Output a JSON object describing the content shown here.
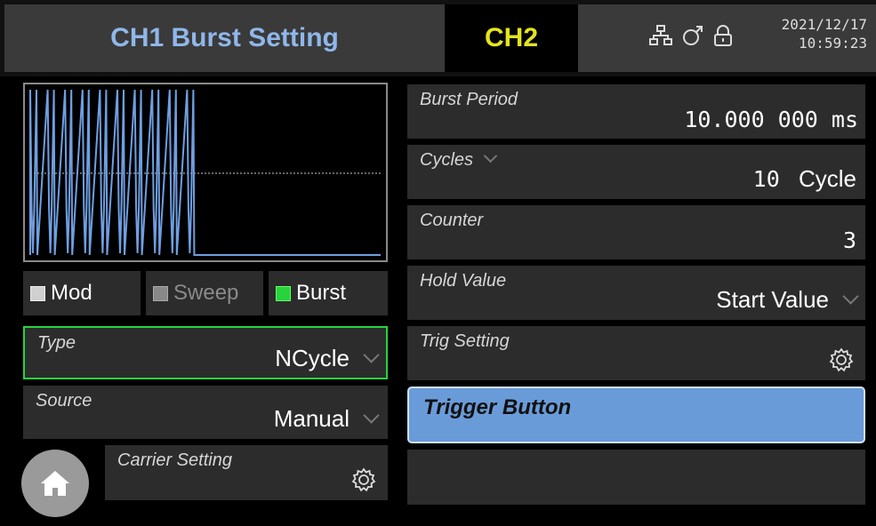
{
  "header": {
    "active_tab": "CH1 Burst Setting",
    "other_tab": "CH2",
    "date": "2021/12/17",
    "time": "10:59:23",
    "icons": [
      "network-icon",
      "link-icon",
      "lock-icon"
    ]
  },
  "waveform": {
    "pulse_count": 10,
    "trace_color": "#6f9fe0",
    "reference_line_color": "#cccccc"
  },
  "modes": {
    "mod": {
      "label": "Mod",
      "enabled": true
    },
    "sweep": {
      "label": "Sweep",
      "enabled": false
    },
    "burst": {
      "label": "Burst",
      "enabled": true,
      "active": true
    }
  },
  "left_settings": {
    "type": {
      "label": "Type",
      "value": "NCycle"
    },
    "source": {
      "label": "Source",
      "value": "Manual"
    },
    "carrier": {
      "label": "Carrier Setting"
    }
  },
  "right_settings": {
    "burst_period": {
      "label": "Burst Period",
      "value": "10.000 000 ms"
    },
    "cycles": {
      "label": "Cycles",
      "value": "10",
      "unit": "Cycle"
    },
    "counter": {
      "label": "Counter",
      "value": "3"
    },
    "hold_value": {
      "label": "Hold Value",
      "value": "Start Value"
    },
    "trig_setting": {
      "label": "Trig Setting"
    },
    "trigger_button": {
      "label": "Trigger Button"
    }
  },
  "colors": {
    "accent_blue": "#6a9bd9",
    "active_green": "#27d43b",
    "ch1_text": "#8fb7ea",
    "ch2_text": "#e3e51c"
  }
}
